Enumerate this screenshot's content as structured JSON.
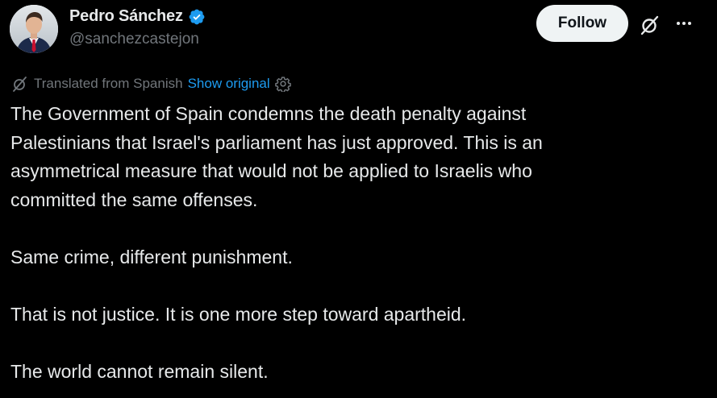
{
  "author": {
    "display_name": "Pedro Sánchez",
    "handle": "@sanchezcastejon",
    "verified": true
  },
  "actions": {
    "follow_label": "Follow"
  },
  "translation": {
    "label": "Translated from Spanish",
    "show_original_label": "Show original"
  },
  "tweet": {
    "paragraph_1": [
      "The Government of Spain condemns the death penalty against",
      "Palestinians that Israel's parliament has just approved. This is an",
      "asymmetrical measure that would not be applied to Israelis who",
      "committed the same offenses."
    ],
    "paragraph_2": "Same crime, different punishment.",
    "paragraph_3": "That is not justice. It is one more step toward apartheid.",
    "paragraph_4": "The world cannot remain silent."
  },
  "colors": {
    "background": "#000000",
    "text_primary": "#e7e9ea",
    "text_secondary": "#71767b",
    "link": "#1d9bf0",
    "verified": "#1d9bf0",
    "follow_bg": "#eff3f4",
    "follow_text": "#0f1419"
  },
  "icons": {
    "verified": "verified-badge-icon",
    "grok": "grok-icon",
    "more": "more-horizontal-icon",
    "translate": "translate-icon",
    "settings": "gear-icon"
  }
}
